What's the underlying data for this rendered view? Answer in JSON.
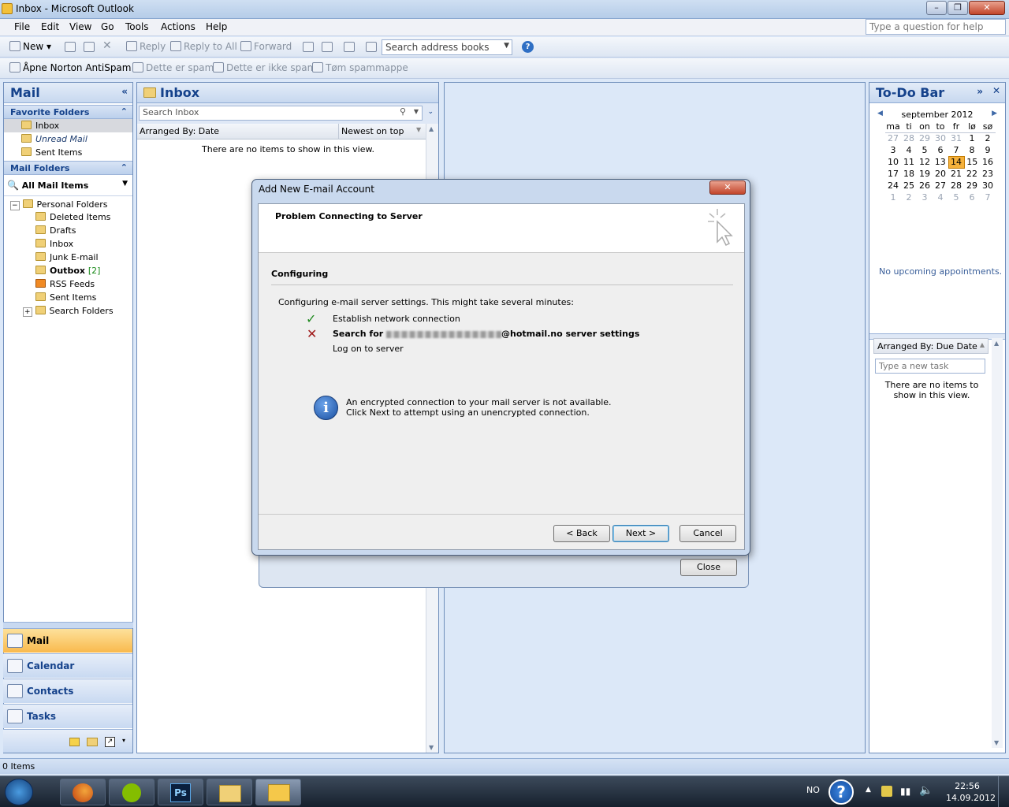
{
  "window": {
    "title": "Inbox - Microsoft Outlook"
  },
  "menu": [
    "File",
    "Edit",
    "View",
    "Go",
    "Tools",
    "Actions",
    "Help"
  ],
  "help_placeholder": "Type a question for help",
  "toolbar": {
    "new": "New",
    "reply": "Reply",
    "reply_all": "Reply to All",
    "forward": "Forward",
    "search_address": "Search address books"
  },
  "antispam": {
    "open": "Åpne Norton AntiSpam",
    "is_spam": "Dette er spam",
    "not_spam": "Dette er ikke spam",
    "empty": "Tøm spammappe"
  },
  "nav": {
    "title": "Mail",
    "favorites_head": "Favorite Folders",
    "favorites": [
      "Inbox",
      "Unread Mail",
      "Sent Items"
    ],
    "mail_folders_head": "Mail Folders",
    "all_mail": "All Mail Items",
    "personal": "Personal Folders",
    "folders": [
      {
        "name": "Deleted Items",
        "count": ""
      },
      {
        "name": "Drafts",
        "count": ""
      },
      {
        "name": "Inbox",
        "count": ""
      },
      {
        "name": "Junk E-mail",
        "count": ""
      },
      {
        "name": "Outbox",
        "count": "[2]"
      },
      {
        "name": "RSS Feeds",
        "count": ""
      },
      {
        "name": "Sent Items",
        "count": ""
      },
      {
        "name": "Search Folders",
        "count": ""
      }
    ],
    "buttons": [
      "Mail",
      "Calendar",
      "Contacts",
      "Tasks"
    ]
  },
  "inbox": {
    "title": "Inbox",
    "search_placeholder": "Search Inbox",
    "arranged": "Arranged By: Date",
    "order": "Newest on top",
    "empty": "There are no items to show in this view."
  },
  "todo": {
    "title": "To-Do Bar",
    "month": "september 2012",
    "days": [
      "ma",
      "ti",
      "on",
      "to",
      "fr",
      "lø",
      "sø"
    ],
    "weeks": [
      [
        "27",
        "28",
        "29",
        "30",
        "31",
        "1",
        "2"
      ],
      [
        "3",
        "4",
        "5",
        "6",
        "7",
        "8",
        "9"
      ],
      [
        "10",
        "11",
        "12",
        "13",
        "14",
        "15",
        "16"
      ],
      [
        "17",
        "18",
        "19",
        "20",
        "21",
        "22",
        "23"
      ],
      [
        "24",
        "25",
        "26",
        "27",
        "28",
        "29",
        "30"
      ],
      [
        "1",
        "2",
        "3",
        "4",
        "5",
        "6",
        "7"
      ]
    ],
    "today": "14",
    "no_appointments": "No upcoming appointments.",
    "arranged": "Arranged By: Due Date",
    "task_placeholder": "Type a new task",
    "empty": "There are no items to show in this view."
  },
  "dialog": {
    "title": "Add New E-mail Account",
    "header": "Problem Connecting to Server",
    "section": "Configuring",
    "intro": "Configuring e-mail server settings. This might take several minutes:",
    "step1": "Establish network connection",
    "step2_prefix": "Search for",
    "step2_suffix": "@hotmail.no server settings",
    "step3": "Log on to server",
    "info1": "An encrypted connection to your mail server is not available.",
    "info2": "Click Next to attempt using an unencrypted connection.",
    "back": "< Back",
    "next": "Next >",
    "cancel": "Cancel",
    "close": "Close"
  },
  "status": {
    "items": "0 Items"
  },
  "taskbar": {
    "lang": "NO",
    "time": "22:56",
    "date": "14.09.2012"
  },
  "colors": {
    "accent": "#15428b",
    "selected_nav": "#f9b94d",
    "today": "#f5b13b"
  }
}
